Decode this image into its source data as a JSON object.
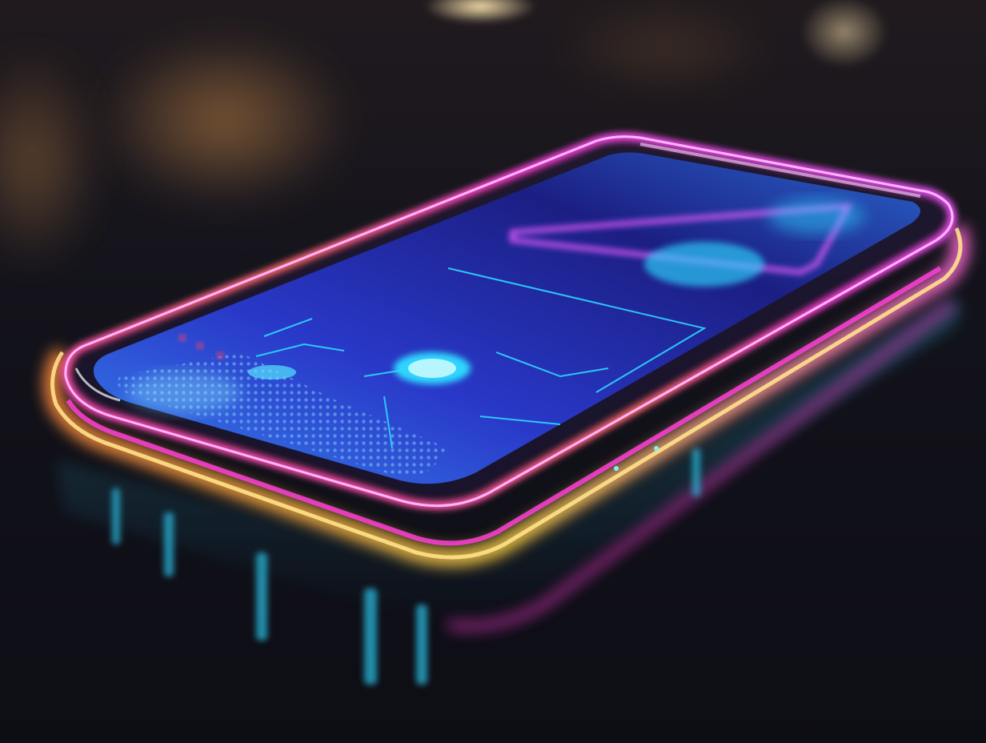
{
  "scene": {
    "subject": "glowing-transparent-smartphone",
    "palette": {
      "background_dark": "#0b0b12",
      "surface_reflection": "#1a1a26",
      "neon_pink": "#ff3ed8",
      "neon_magenta": "#d04bff",
      "neon_orange": "#ff9a3c",
      "neon_yellow": "#ffd84a",
      "screen_blue": "#2a3bd6",
      "screen_cyan": "#2fd6ff",
      "bokeh_warm": "#c98a4a"
    },
    "icons": [
      "phone-icon",
      "hologram-circuit-icon",
      "fingerprint-glow-icon"
    ]
  }
}
